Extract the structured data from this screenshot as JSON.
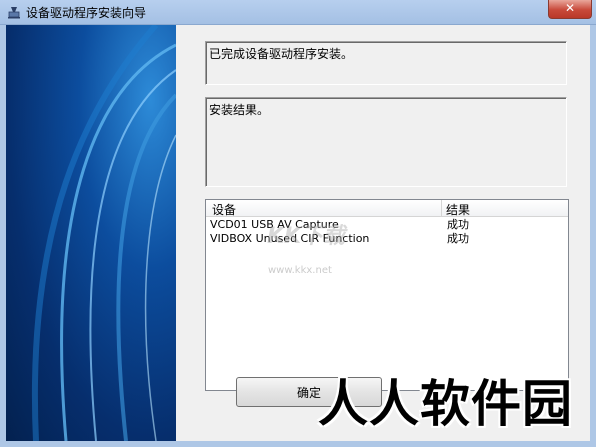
{
  "window": {
    "title": "设备驱动程序安装向导",
    "close_label": "✕"
  },
  "status_box": {
    "text": "已完成设备驱动程序安装。"
  },
  "result_box": {
    "text": "安装结果。"
  },
  "device_list": {
    "columns": [
      "设备",
      "结果"
    ],
    "rows": [
      {
        "device": "VCD01 USB AV Capture",
        "result": "成功"
      },
      {
        "device": "VIDBOX Unused CIR Function",
        "result": "成功"
      }
    ]
  },
  "buttons": {
    "ok_label": "确定"
  },
  "watermarks": {
    "center_logo": "KK下载",
    "center_url": "www.kkx.net",
    "corner_text": "人人软件园"
  },
  "colors": {
    "window_frame": "#aec7e6",
    "side_art_blue": "#0c4d9e",
    "close_red": "#c8493a"
  }
}
